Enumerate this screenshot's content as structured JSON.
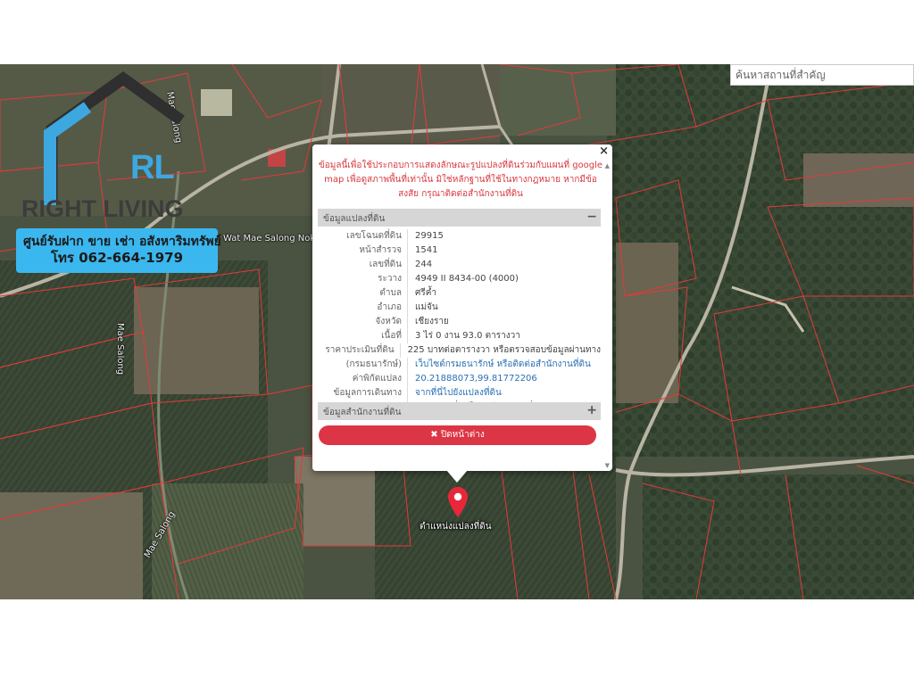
{
  "search": {
    "placeholder": "ค้นหาสถานที่สำคัญ"
  },
  "map_labels": {
    "temple": "Wat Mae Salong Nok",
    "road_top": "Mae Salong",
    "road_bottom": "Mae Salong",
    "road_mid": "Mae Salong"
  },
  "logo": {
    "mark": "RL",
    "name": "RIGHT LIVING",
    "tagline": "ศูนย์รับฝาก ขาย เช่า อสังหาริมทรัพย์",
    "phone": "โทร 062-664-1979"
  },
  "popup": {
    "close_symbol": "×",
    "notice": "ข้อมูลนี้เพื่อใช้ประกอบการแสดงลักษณะรูปแปลงที่ดินร่วมกับแผนที่ google map เพื่อดูสภาพพื้นที่เท่านั้น มิใช่หลักฐานที่ใช้ในทางกฎหมาย หากมีข้อสงสัย กรุณาติดต่อสำนักงานที่ดิน",
    "section_parcel": "ข้อมูลแปลงที่ดิน",
    "section_parcel_toggle": "−",
    "section_office": "ข้อมูลสำนักงานที่ดิน",
    "section_office_toggle": "+",
    "rows": [
      {
        "key": "เลขโฉนดที่ดิน",
        "value": "29915"
      },
      {
        "key": "หน้าสำรวจ",
        "value": "1541"
      },
      {
        "key": "เลขที่ดิน",
        "value": "244"
      },
      {
        "key": "ระวาง",
        "value": "4949 II 8434-00 (4000)"
      },
      {
        "key": "ตำบล",
        "value": "ศรีค้ำ"
      },
      {
        "key": "อำเภอ",
        "value": "แม่จัน"
      },
      {
        "key": "จังหวัด",
        "value": "เชียงราย"
      },
      {
        "key": "เนื้อที่",
        "value": "3 ไร่ 0 งาน 93.0 ตารางวา"
      },
      {
        "key": "ราคาประเมินที่ดิน",
        "value": "225 บาทต่อตารางวา หรือตรวจสอบข้อมูลผ่านทาง"
      },
      {
        "key": "(กรมธนารักษ์)",
        "value": "เว็บไซต์กรมธนารักษ์ หรือติดต่อสำนักงานที่ดิน"
      },
      {
        "key": "ค่าพิกัดแปลง",
        "value": "20.21888073,99.81772206"
      },
      {
        "key": "ข้อมูลการเดินทาง",
        "value": "จากที่นี่ไปยังแปลงที่ดิน"
      },
      {
        "key": "",
        "value": "จากแปลงที่ดินไปยังสำนักงานที่ดิน"
      }
    ],
    "close_button": "✖ ปิดหน้าต่าง"
  },
  "pin": {
    "label": "ตำแหน่งแปลงที่ดิน",
    "icon": "map-pin-icon"
  },
  "colors": {
    "parcel_line": "#e23a3a",
    "close_button": "#dc3545",
    "notice_text": "#d8393f",
    "logo_blue": "#3bb7ef"
  }
}
